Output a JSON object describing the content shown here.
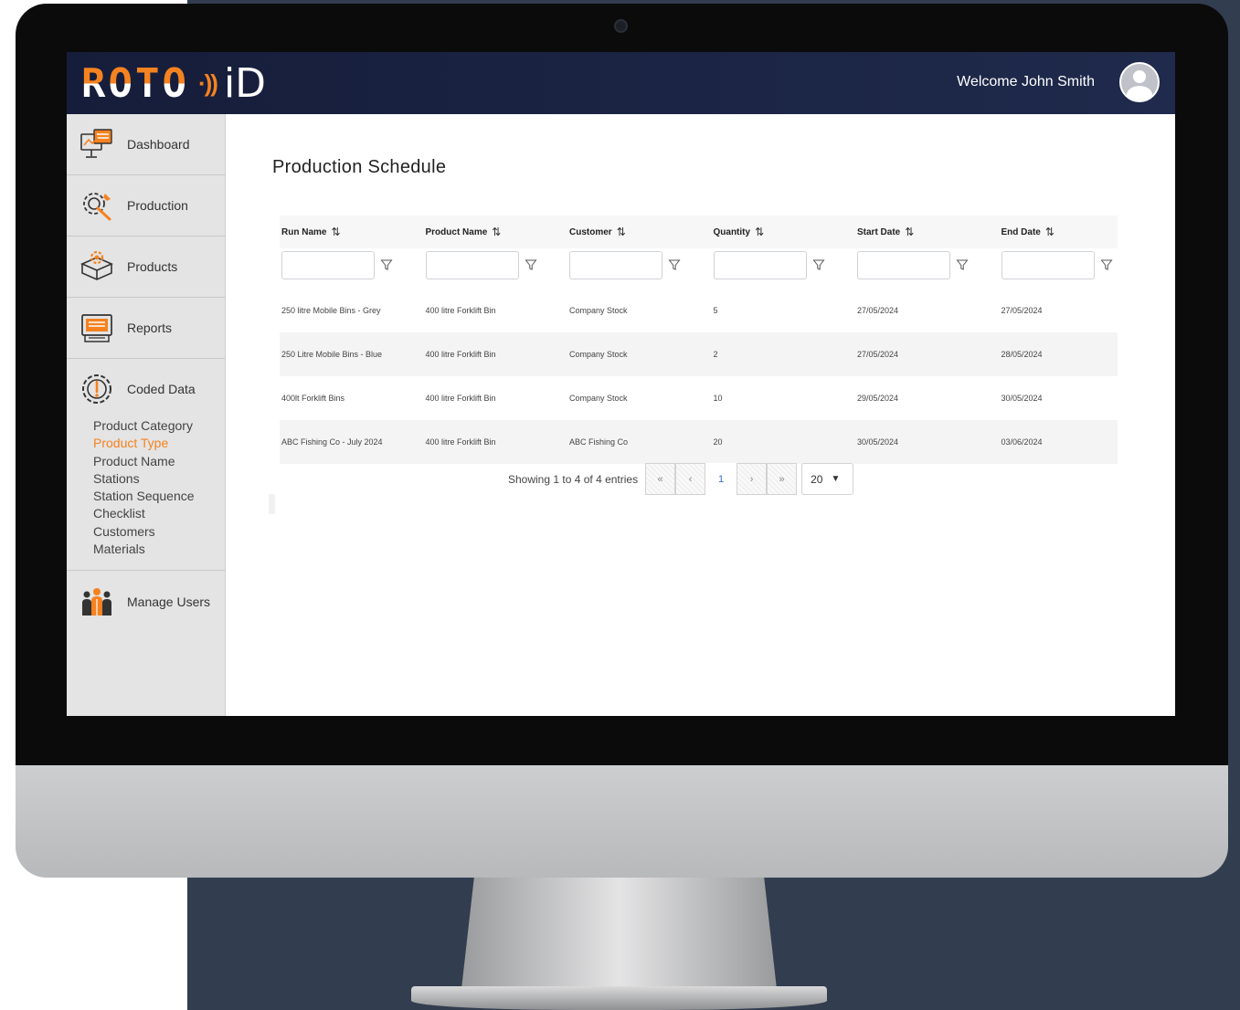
{
  "header": {
    "logo_main": "ROTO",
    "logo_waves": "·))",
    "logo_id": "iD",
    "welcome": "Welcome John Smith"
  },
  "sidebar": {
    "items": [
      {
        "label": "Dashboard",
        "icon": "dashboard-icon"
      },
      {
        "label": "Production",
        "icon": "production-gear-icon"
      },
      {
        "label": "Products",
        "icon": "products-box-icon"
      },
      {
        "label": "Reports",
        "icon": "reports-icon"
      },
      {
        "label": "Coded Data",
        "icon": "coded-data-icon"
      },
      {
        "label": "Manage Users",
        "icon": "manage-users-icon"
      }
    ],
    "coded_submenu": [
      "Product Category",
      "Product Type",
      "Product Name",
      "Stations",
      "Station Sequence",
      "Checklist",
      "Customers",
      "Materials"
    ],
    "active_submenu": "Product Type"
  },
  "main": {
    "title": "Production Schedule",
    "columns": [
      "Run Name",
      "Product Name",
      "Customer",
      "Quantity",
      "Start Date",
      "End Date"
    ],
    "rows": [
      [
        "250 litre Mobile Bins - Grey",
        "400 litre Forklift Bin",
        "Company Stock",
        "5",
        "27/05/2024",
        "27/05/2024"
      ],
      [
        "250 Litre Mobile Bins - Blue",
        "400 litre Forklift Bin",
        "Company Stock",
        "2",
        "27/05/2024",
        "28/05/2024"
      ],
      [
        "400lt Forklift Bins",
        "400 litre Forklift Bin",
        "Company Stock",
        "10",
        "29/05/2024",
        "30/05/2024"
      ],
      [
        "ABC Fishing Co - July 2024",
        "400 litre Forklift Bin",
        "ABC Fishing Co",
        "20",
        "30/05/2024",
        "03/06/2024"
      ]
    ],
    "pagination": {
      "summary": "Showing 1 to 4 of 4 entries",
      "first": "«",
      "prev": "‹",
      "current": "1",
      "next": "›",
      "last": "»",
      "page_size": "20"
    }
  },
  "colors": {
    "accent": "#f58220",
    "topbar": "#1a2242",
    "sidebar": "#e4e4e4",
    "backdrop": "#323d4f"
  }
}
